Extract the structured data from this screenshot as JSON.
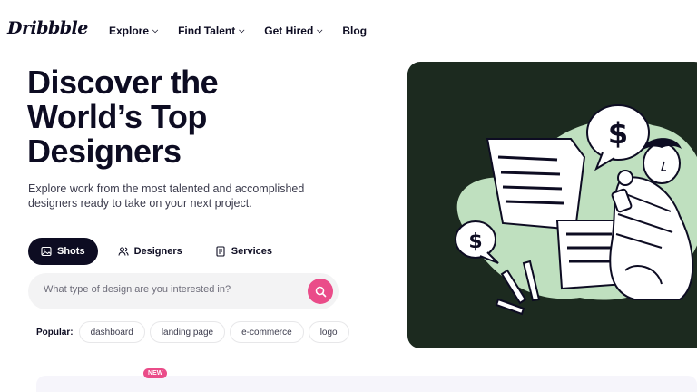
{
  "brand": {
    "logo": "Dribbble"
  },
  "nav": {
    "items": [
      {
        "label": "Explore",
        "has_dropdown": true
      },
      {
        "label": "Find Talent",
        "has_dropdown": true
      },
      {
        "label": "Get Hired",
        "has_dropdown": true
      },
      {
        "label": "Blog",
        "has_dropdown": false
      }
    ],
    "chevron": "chevron-down-icon"
  },
  "hero": {
    "title_line1": "Discover the",
    "title_line2": "World’s Top",
    "title_line3": "Designers",
    "subtitle": "Explore work from the most talented and accomplished designers ready to take on your next project."
  },
  "tabs": [
    {
      "label": "Shots",
      "icon": "image-icon",
      "active": true
    },
    {
      "label": "Designers",
      "icon": "people-icon",
      "active": false
    },
    {
      "label": "Services",
      "icon": "document-icon",
      "active": false
    }
  ],
  "search": {
    "placeholder": "What type of design are you interested in?",
    "value": "",
    "button_icon": "search-icon"
  },
  "popular": {
    "label": "Popular:",
    "chips": [
      "dashboard",
      "landing page",
      "e-commerce",
      "logo"
    ]
  },
  "banner": {
    "badge": "NEW"
  },
  "colors": {
    "accent": "#ea4c89",
    "text": "#0d0c22",
    "hero_panel": "#1c2a1f",
    "art_green": "#bfe0bf"
  }
}
